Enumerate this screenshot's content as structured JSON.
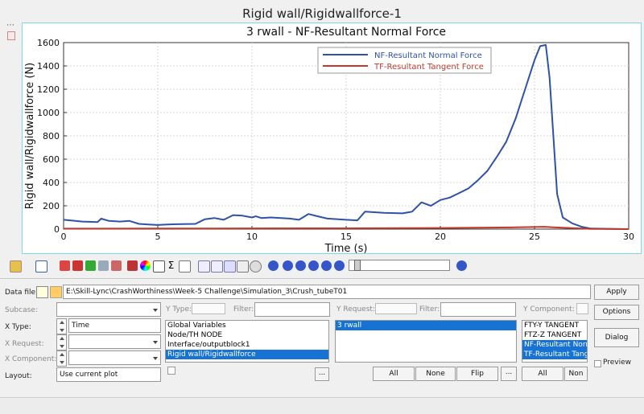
{
  "window": {
    "title": "Rigid wall/Rigidwallforce-1"
  },
  "chart_data": {
    "type": "line",
    "title": "3 rwall - NF-Resultant Normal Force",
    "xlabel": "Time (s)",
    "ylabel": "Rigid wall/Rigidwallforce (N)",
    "xlim": [
      0,
      30
    ],
    "ylim": [
      0,
      1600
    ],
    "xticks": [
      "0",
      "5",
      "10",
      "15",
      "20",
      "25",
      "30"
    ],
    "yticks": [
      "0",
      "200",
      "400",
      "600",
      "800",
      "1000",
      "1200",
      "1400",
      "1600"
    ],
    "grid": true,
    "legend_position": "top-right",
    "series": [
      {
        "name": "NF-Resultant Normal Force",
        "color": "#2f52a8",
        "points": [
          [
            0,
            80
          ],
          [
            1,
            65
          ],
          [
            1.8,
            60
          ],
          [
            2,
            90
          ],
          [
            2.4,
            70
          ],
          [
            3,
            65
          ],
          [
            3.5,
            70
          ],
          [
            4,
            45
          ],
          [
            4.5,
            40
          ],
          [
            5,
            35
          ],
          [
            5.5,
            40
          ],
          [
            6,
            42
          ],
          [
            7,
            45
          ],
          [
            7.5,
            85
          ],
          [
            8,
            95
          ],
          [
            8.5,
            80
          ],
          [
            9,
            120
          ],
          [
            9.5,
            115
          ],
          [
            10,
            100
          ],
          [
            10.2,
            110
          ],
          [
            10.5,
            95
          ],
          [
            11,
            100
          ],
          [
            12,
            90
          ],
          [
            12.5,
            80
          ],
          [
            13,
            130
          ],
          [
            13.5,
            110
          ],
          [
            14,
            90
          ],
          [
            15,
            80
          ],
          [
            15.6,
            75
          ],
          [
            16,
            150
          ],
          [
            17,
            140
          ],
          [
            18,
            135
          ],
          [
            18.5,
            150
          ],
          [
            19,
            230
          ],
          [
            19.5,
            200
          ],
          [
            20,
            250
          ],
          [
            20.5,
            270
          ],
          [
            21,
            310
          ],
          [
            21.5,
            350
          ],
          [
            22,
            420
          ],
          [
            22.5,
            500
          ],
          [
            23,
            620
          ],
          [
            23.5,
            750
          ],
          [
            24,
            950
          ],
          [
            24.5,
            1200
          ],
          [
            25,
            1450
          ],
          [
            25.3,
            1570
          ],
          [
            25.6,
            1580
          ],
          [
            25.8,
            1300
          ],
          [
            26,
            800
          ],
          [
            26.2,
            300
          ],
          [
            26.5,
            100
          ],
          [
            27,
            50
          ],
          [
            27.5,
            20
          ],
          [
            28,
            5
          ],
          [
            30,
            0
          ]
        ]
      },
      {
        "name": "TF-Resultant Tangent Force",
        "color": "#c0392b",
        "points": [
          [
            0,
            4
          ],
          [
            5,
            5
          ],
          [
            10,
            6
          ],
          [
            15,
            7
          ],
          [
            20,
            10
          ],
          [
            24,
            15
          ],
          [
            25.5,
            20
          ],
          [
            26,
            15
          ],
          [
            27,
            8
          ],
          [
            28,
            2
          ],
          [
            30,
            0
          ]
        ]
      }
    ]
  },
  "panel": {
    "data_file_label": "Data file:",
    "data_file_value": "E:\\Skill-Lync\\CrashWorthiness\\Week-5 Challenge\\Simulation_3\\Crush_tubeT01",
    "apply_label": "Apply",
    "options_label": "Options",
    "dialog_label": "Dialog",
    "preview_label": "Preview",
    "subcase_label": "Subcase:",
    "xtype_label": "X Type:",
    "xtype_value": "Time",
    "xrequest_label": "X Request:",
    "xcomponent_label": "X Component:",
    "layout_label": "Layout:",
    "layout_value": "Use current plot",
    "ytype_label": "Y Type:",
    "filter_label": "Filter:",
    "yrequest_label": "Y Request:",
    "ycomponent_label": "Y Component:",
    "ytype_items": [
      "Global Variables",
      "Node/TH NODE",
      "Interface/outputblock1",
      "Rigid wall/Rigidwallforce"
    ],
    "yrequest_items": [
      "3 rwall"
    ],
    "ycomponent_items": [
      "FTY-Y TANGENT",
      "FTZ-Z TANGENT",
      "NF-Resultant Norm",
      "TF-Resultant Tang"
    ],
    "ellipsis": "...",
    "all_label": "All",
    "none_label": "None",
    "flip_label": "Flip",
    "non_label": "Non"
  }
}
